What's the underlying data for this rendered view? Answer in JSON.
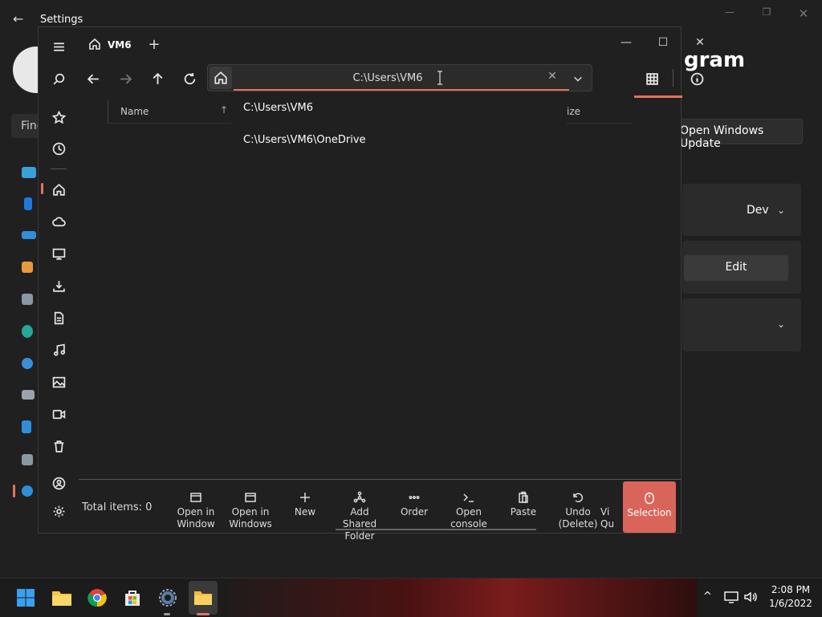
{
  "settings": {
    "title": "Settings",
    "heading_partial": "gram",
    "update_button": "Open Windows Update",
    "find_partial": "Finc",
    "dev_label": "Dev",
    "edit_button": "Edit"
  },
  "files": {
    "tab_label": "VM6",
    "address_value": "C:\\Users\\VM6",
    "columns": {
      "name": "Name",
      "size_partial": "ize"
    },
    "suggestions": [
      "C:\\Users\\VM6",
      "C:\\Users\\VM6\\OneDrive"
    ],
    "total_items": "Total items: 0",
    "actions": [
      {
        "label": "Open in",
        "label2": "Window",
        "icon": "window-icon"
      },
      {
        "label": "Open in",
        "label2": "Windows",
        "icon": "windows-terminal-icon"
      },
      {
        "label": "New",
        "label2": "",
        "icon": "plus-icon"
      },
      {
        "label": "Add Shared",
        "label2": "Folder",
        "icon": "share-icon"
      },
      {
        "label": "Order",
        "label2": "",
        "icon": "more-icon"
      },
      {
        "label": "Open",
        "label2": "console",
        "icon": "console-icon"
      },
      {
        "label": "Paste",
        "label2": "",
        "icon": "paste-icon"
      },
      {
        "label": "Undo",
        "label2": "(Delete)",
        "icon": "undo-icon"
      },
      {
        "label": "Vi",
        "label2": "Qu",
        "icon": "view-icon"
      }
    ],
    "selection_label": "Selection"
  },
  "taskbar": {
    "time": "2:08 PM",
    "date": "1/6/2022"
  },
  "colors": {
    "accent": "#e4735c",
    "selection_bg": "#d9645a"
  }
}
